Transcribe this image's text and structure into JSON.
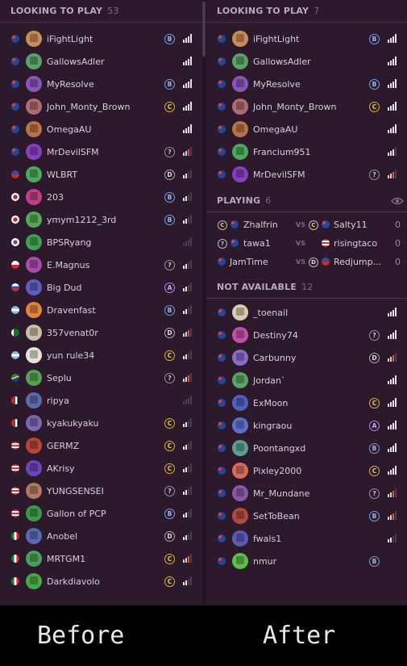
{
  "colors": {
    "panel_bg": "#2c1a2c",
    "badge_B": "#7c9bd8",
    "badge_C": "#d8b04a",
    "badge_A": "#b387e0",
    "signal_active": "#e8e3e8",
    "signal_warn": "#d9583f"
  },
  "before": {
    "section_title": "LOOKING TO PLAY",
    "section_count": "53",
    "players": [
      {
        "name": "iFightLight",
        "flag": "au",
        "av": "#c98c56",
        "badge": "B",
        "signal": "4"
      },
      {
        "name": "GallowsAdler",
        "flag": "au",
        "av": "#5aa266",
        "badge": "",
        "signal": "4"
      },
      {
        "name": "MyResolve",
        "flag": "au",
        "av": "#8a55b8",
        "badge": "B",
        "signal": "4"
      },
      {
        "name": "John_Monty_Brown",
        "flag": "au",
        "av": "#b06a72",
        "badge": "C",
        "signal": "4"
      },
      {
        "name": "OmegaAU",
        "flag": "au",
        "av": "#b87446",
        "badge": "",
        "signal": "4"
      },
      {
        "name": "MrDevilSFM",
        "flag": "au",
        "av": "#8540c0",
        "badge": "?",
        "signal": "r"
      },
      {
        "name": "WLBRT",
        "flag": "ph",
        "av": "#4caa5a",
        "badge": "D",
        "signal": "2"
      },
      {
        "name": "203",
        "flag": "jp",
        "av": "#c03f8a",
        "badge": "B",
        "signal": "2"
      },
      {
        "name": "ymym1212_3rd",
        "flag": "jp",
        "av": "#55a855",
        "badge": "B",
        "signal": "2"
      },
      {
        "name": "BPSRyang",
        "flag": "kr",
        "av": "#3fa04f",
        "badge": "",
        "signal": "0"
      },
      {
        "name": "E.Magnus",
        "flag": "cl",
        "av": "#a74aa8",
        "badge": "?",
        "signal": "2"
      },
      {
        "name": "Big Dud",
        "flag": "ru",
        "av": "#5f5ec0",
        "badge": "A",
        "signal": "2"
      },
      {
        "name": "Dravenfast",
        "flag": "ar",
        "av": "#e0843f",
        "badge": "B",
        "signal": "2"
      },
      {
        "name": "357venat0r",
        "flag": "pk",
        "av": "#c8c0a8",
        "badge": "D",
        "signal": "r"
      },
      {
        "name": "yun rule34",
        "flag": "ar",
        "av": "#e8e3da",
        "badge": "C",
        "signal": "2"
      },
      {
        "name": "Seplu",
        "flag": "za",
        "av": "#55a055",
        "badge": "?",
        "signal": "r"
      },
      {
        "name": "ripya",
        "flag": "ae",
        "av": "#5e6aa8",
        "badge": "",
        "signal": "0"
      },
      {
        "name": "kyakukyaku",
        "flag": "ae",
        "av": "#7b68b0",
        "badge": "C",
        "signal": "2"
      },
      {
        "name": "GERMZ",
        "flag": "us",
        "av": "#b84638",
        "badge": "C",
        "signal": "2"
      },
      {
        "name": "AKrisy",
        "flag": "us",
        "av": "#6e44b8",
        "badge": "C",
        "signal": "2"
      },
      {
        "name": "YUNGSENSEI",
        "flag": "us",
        "av": "#b07a62",
        "badge": "?",
        "signal": "2"
      },
      {
        "name": "Gallon of PCP",
        "flag": "us",
        "av": "#3a9a4a",
        "badge": "B",
        "signal": "2"
      },
      {
        "name": "Anobel",
        "flag": "mx",
        "av": "#5a6ab0",
        "badge": "D",
        "signal": "2"
      },
      {
        "name": "MRTGM1",
        "flag": "mx",
        "av": "#4aa05a",
        "badge": "C",
        "signal": "r"
      },
      {
        "name": "Darkdiavolo",
        "flag": "mx",
        "av": "#48a848",
        "badge": "C",
        "signal": "2"
      }
    ]
  },
  "after": {
    "looking": {
      "title": "LOOKING TO PLAY",
      "count": "7",
      "players": [
        {
          "name": "iFightLight",
          "flag": "au",
          "av": "#c98c56",
          "badge": "B",
          "signal": "4"
        },
        {
          "name": "GallowsAdler",
          "flag": "au",
          "av": "#5aa266",
          "badge": "",
          "signal": "4"
        },
        {
          "name": "MyResolve",
          "flag": "au",
          "av": "#8a55b8",
          "badge": "B",
          "signal": "4"
        },
        {
          "name": "John_Monty_Brown",
          "flag": "au",
          "av": "#b06a72",
          "badge": "C",
          "signal": "4"
        },
        {
          "name": "OmegaAU",
          "flag": "au",
          "av": "#b87446",
          "badge": "",
          "signal": "4"
        },
        {
          "name": "Francium951",
          "flag": "au",
          "av": "#4caa5a",
          "badge": "",
          "signal": "3"
        },
        {
          "name": "MrDevilSFM",
          "flag": "au",
          "av": "#8540c0",
          "badge": "?",
          "signal": "r"
        }
      ]
    },
    "playing": {
      "title": "PLAYING",
      "count": "6",
      "vs_label": "VS",
      "matches": [
        {
          "p1": "Zhalfrin",
          "b1": "C",
          "f1": "au",
          "p2": "Salty11",
          "b2": "C",
          "f2": "au",
          "score": "0"
        },
        {
          "p1": "tawa1",
          "b1": "?",
          "f1": "au",
          "p2": "risingtaco",
          "b2": "",
          "f2": "us",
          "score": "0"
        },
        {
          "p1": "JamTime",
          "b1": "",
          "f1": "au",
          "p2": "Redjump...",
          "b2": "D",
          "f2": "ph",
          "score": "0"
        }
      ]
    },
    "unavailable": {
      "title": "NOT AVAILABLE",
      "count": "12",
      "players": [
        {
          "name": "_toenail",
          "flag": "au",
          "av": "#d8ccb0",
          "badge": "",
          "signal": "4"
        },
        {
          "name": "Destiny74",
          "flag": "au",
          "av": "#c050a8",
          "badge": "?",
          "signal": "4"
        },
        {
          "name": "Carbunny",
          "flag": "au",
          "av": "#8a6ac8",
          "badge": "D",
          "signal": "r"
        },
        {
          "name": "Jordan`",
          "flag": "au",
          "av": "#5aa266",
          "badge": "",
          "signal": "4"
        },
        {
          "name": "ExMoon",
          "flag": "au",
          "av": "#5060c0",
          "badge": "C",
          "signal": "4"
        },
        {
          "name": "kingraou",
          "flag": "au",
          "av": "#6070c8",
          "badge": "A",
          "signal": "4"
        },
        {
          "name": "Poontangxd",
          "flag": "au",
          "av": "#5aa090",
          "badge": "B",
          "signal": "4"
        },
        {
          "name": "Pixley2000",
          "flag": "au",
          "av": "#d86a5a",
          "badge": "C",
          "signal": "4"
        },
        {
          "name": "Mr_Mundane",
          "flag": "au",
          "av": "#8a58a8",
          "badge": "?",
          "signal": "r"
        },
        {
          "name": "SetToBean",
          "flag": "au",
          "av": "#b04a40",
          "badge": "B",
          "signal": "r"
        },
        {
          "name": "fwals1",
          "flag": "au",
          "av": "#5a5ab8",
          "badge": "",
          "signal": "2"
        },
        {
          "name": "nmur",
          "flag": "au",
          "av": "#5ac04a",
          "badge": "B",
          "signal": "none"
        }
      ]
    }
  },
  "captions": {
    "left": "Before",
    "right": "After"
  }
}
